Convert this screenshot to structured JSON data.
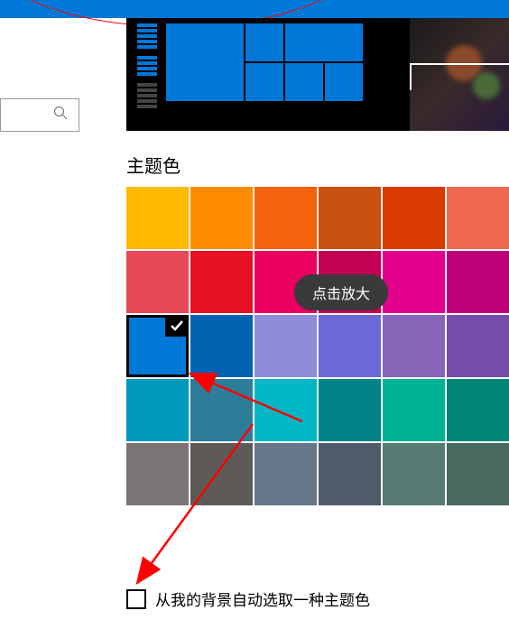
{
  "heading": "主题色",
  "tooltip": "点击放大",
  "checkbox": {
    "label": "从我的背景自动选取一种主题色",
    "checked": false
  },
  "selected_index": 12,
  "colors": [
    "#FFB900",
    "#FF8C00",
    "#F7630C",
    "#CA5010",
    "#DA3B01",
    "#EF6950",
    "#E74856",
    "#E81123",
    "#EA005E",
    "#C30052",
    "#E3008C",
    "#BF0077",
    "#0078D7",
    "#0063B1",
    "#8E8CD8",
    "#6B69D6",
    "#8764B8",
    "#744DA9",
    "#0099BC",
    "#2D7D9A",
    "#00B7C3",
    "#038387",
    "#00B294",
    "#018574",
    "#7A7574",
    "#5D5A58",
    "#68768A",
    "#515C6B",
    "#567C73",
    "#486860"
  ],
  "search": {
    "placeholder": ""
  }
}
